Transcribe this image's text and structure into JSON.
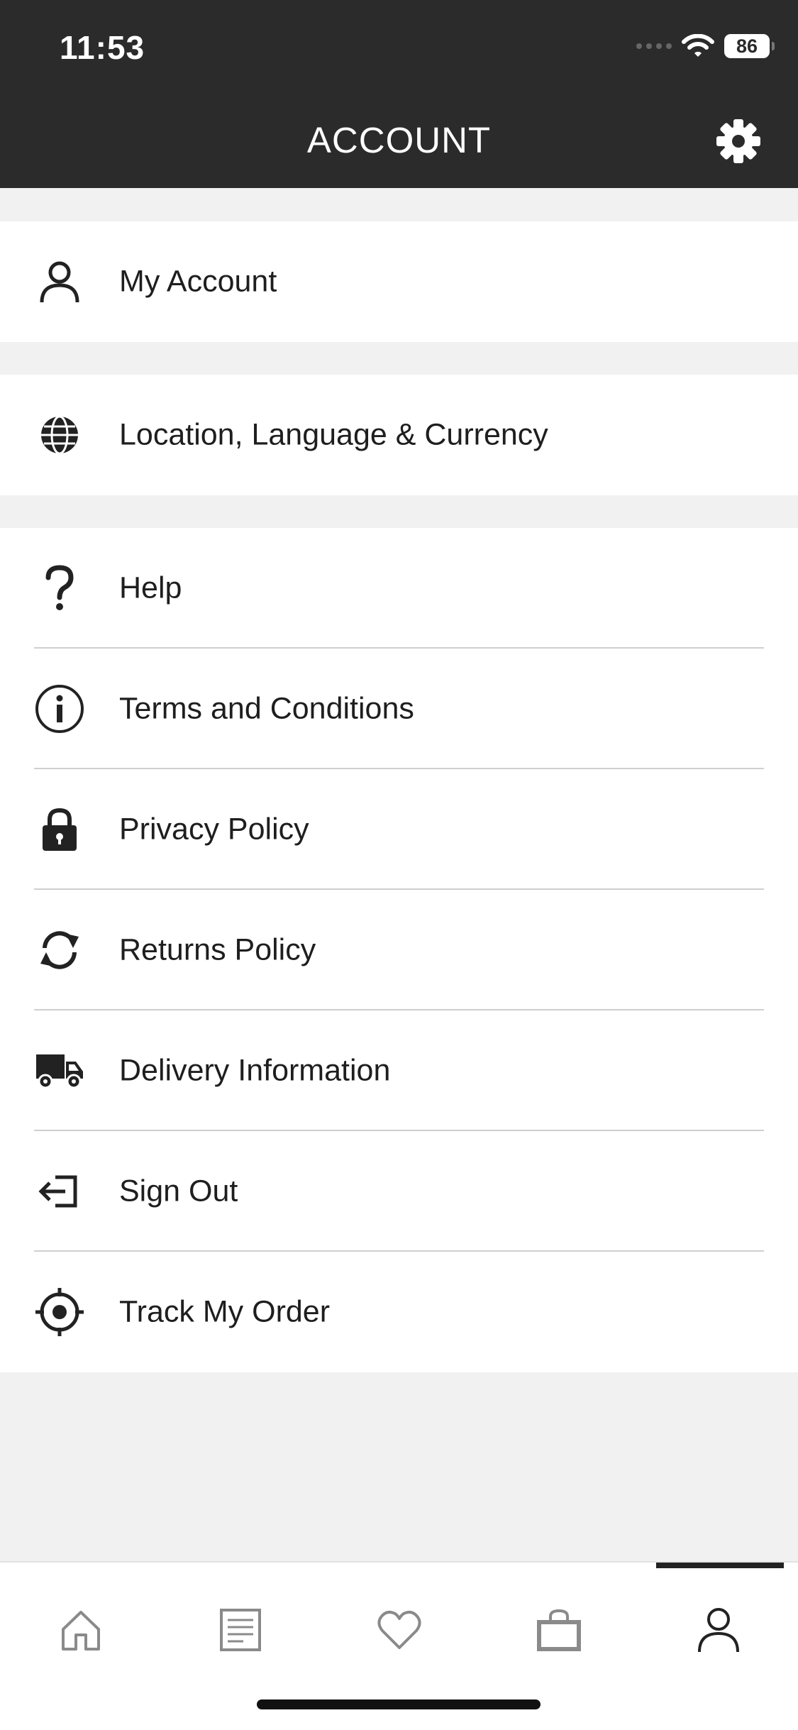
{
  "status_bar": {
    "time": "11:53",
    "battery": "86"
  },
  "header": {
    "title": "ACCOUNT"
  },
  "menu": {
    "my_account": "My Account",
    "location": "Location, Language & Currency",
    "help": "Help",
    "terms": "Terms and Conditions",
    "privacy": "Privacy Policy",
    "returns": "Returns Policy",
    "delivery": "Delivery Information",
    "sign_out": "Sign Out",
    "track_order": "Track My Order"
  },
  "tabbar": {
    "active_tab": "account",
    "icons": [
      "home-icon",
      "catalog-icon",
      "heart-icon",
      "bag-icon",
      "account-icon"
    ]
  },
  "colors": {
    "header_bg": "#2b2b2b",
    "page_bg": "#f1f1f1",
    "text": "#1e1e1e",
    "tab_inactive": "#8a8a8a",
    "tab_active": "#222222"
  }
}
